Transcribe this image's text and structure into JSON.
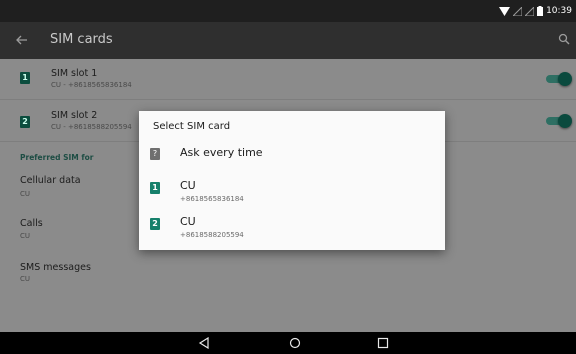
{
  "status": {
    "time": "10:39"
  },
  "appbar": {
    "title": "SIM cards"
  },
  "slots": [
    {
      "badge": "1",
      "title": "SIM slot 1",
      "sub": "CU - +8618565836184",
      "enabled": true
    },
    {
      "badge": "2",
      "title": "SIM slot 2",
      "sub": "CU - +8618588205594",
      "enabled": true
    }
  ],
  "preferred": {
    "header": "Preferred SIM for",
    "items": [
      {
        "title": "Cellular data",
        "sub": "CU"
      },
      {
        "title": "Calls",
        "sub": "CU"
      },
      {
        "title": "SMS messages",
        "sub": "CU"
      }
    ]
  },
  "dialog": {
    "title": "Select SIM card",
    "ask": {
      "icon": "?",
      "label": "Ask every time"
    },
    "options": [
      {
        "badge": "1",
        "name": "CU",
        "number": "+8618565836184"
      },
      {
        "badge": "2",
        "name": "CU",
        "number": "+8618588205594"
      }
    ]
  },
  "colors": {
    "accent": "#16806b",
    "toggle": "#0a4a3e",
    "dim_bg": "#8b8b8b"
  },
  "icons": [
    "back-arrow-icon",
    "search-icon",
    "wifi-icon",
    "signal-icon",
    "battery-icon",
    "nav-back-icon",
    "nav-home-icon",
    "nav-recent-icon"
  ]
}
